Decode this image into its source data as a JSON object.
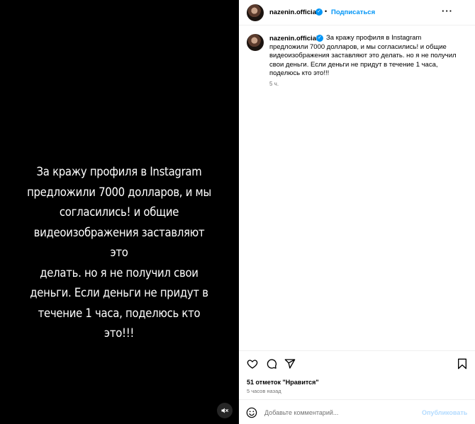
{
  "media": {
    "overlay_lines": [
      "За кражу профиля в Instagram",
      "предложили 7000 долларов, и мы",
      "согласились! и общие",
      "видеоизображения заставляют это",
      "делать. но я не получил свои",
      "деньги. Если деньги не придут в",
      "течение 1 часа, поделюсь кто это!!!"
    ],
    "mute_icon": "speaker-muted-icon"
  },
  "header": {
    "username": "nazenin.official",
    "verified_icon": "verified-badge-icon",
    "separator": "•",
    "follow_label": "Подписаться",
    "more_label": "···"
  },
  "caption": {
    "username": "nazenin.official",
    "text": "За кражу профиля в Instagram предложили 7000 долларов, и мы согласились! и общие видеоизображения заставляют это делать. но я не получил свои деньги. Если деньги не придут в течение 1 часа, поделюсь кто это!!!",
    "time": "5 ч."
  },
  "actions": {
    "likes": "51 отметок \"Нравится\"",
    "posted_time": "5 часов назад"
  },
  "comment_bar": {
    "placeholder": "Добавьте комментарий...",
    "publish_label": "Опубликовать"
  },
  "colors": {
    "accent": "#0095f6",
    "publish_disabled": "#b3dbff",
    "muted_text": "#737373",
    "media_bg": "#000000"
  }
}
